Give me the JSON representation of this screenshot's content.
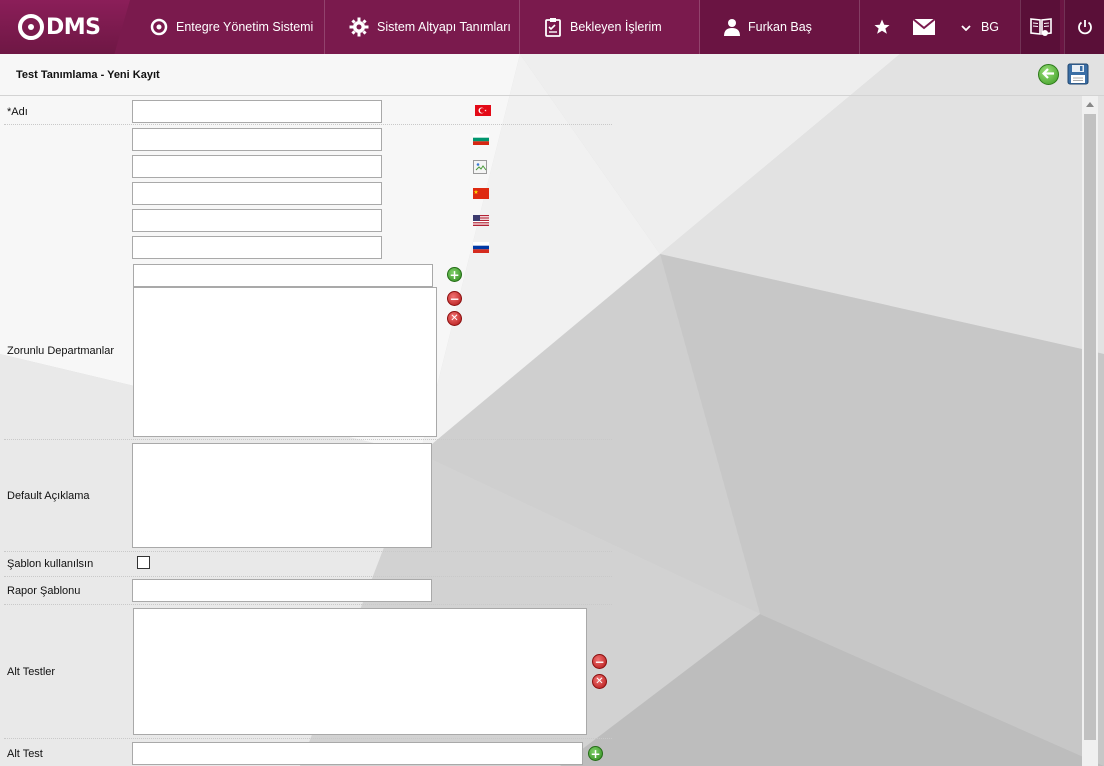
{
  "header": {
    "logo_text": "DMS",
    "menu": [
      {
        "label": "Entegre Yönetim Sistemi",
        "icon": "qdms-circle-icon"
      },
      {
        "label": "Sistem Altyapı Tanımları",
        "icon": "gear-icon"
      },
      {
        "label": "Bekleyen İşlerim",
        "icon": "clipboard-icon"
      },
      {
        "label": "Furkan Baş",
        "icon": "user-icon"
      }
    ],
    "language": "BG",
    "icons": [
      "star-icon",
      "mail-icon",
      "chevron-down-icon",
      "book-help-icon",
      "power-icon"
    ]
  },
  "panel": {
    "title": "Test Tanımlama - Yeni Kayıt"
  },
  "form": {
    "name_label": "*Adı",
    "name_values": [
      "",
      "",
      "",
      "",
      "",
      ""
    ],
    "name_flags": [
      "flag-tr-icon",
      "flag-bg-icon",
      "broken-image-icon",
      "flag-cn-icon",
      "flag-us-icon",
      "flag-ru-icon"
    ],
    "departments_label": "Zorunlu Departmanlar",
    "departments_input": "",
    "description_label": "Default Açıklama",
    "description_value": "",
    "use_template_label": "Şablon kullanılsın",
    "use_template_checked": false,
    "report_template_label": "Rapor Şablonu",
    "report_template_value": "",
    "subtests_label": "Alt Testler",
    "subtest_label": "Alt Test",
    "subtest_value": ""
  },
  "colors": {
    "header_bg": "#7a1a4d",
    "add_green": "#2f8a1d",
    "remove_red": "#b01515"
  }
}
